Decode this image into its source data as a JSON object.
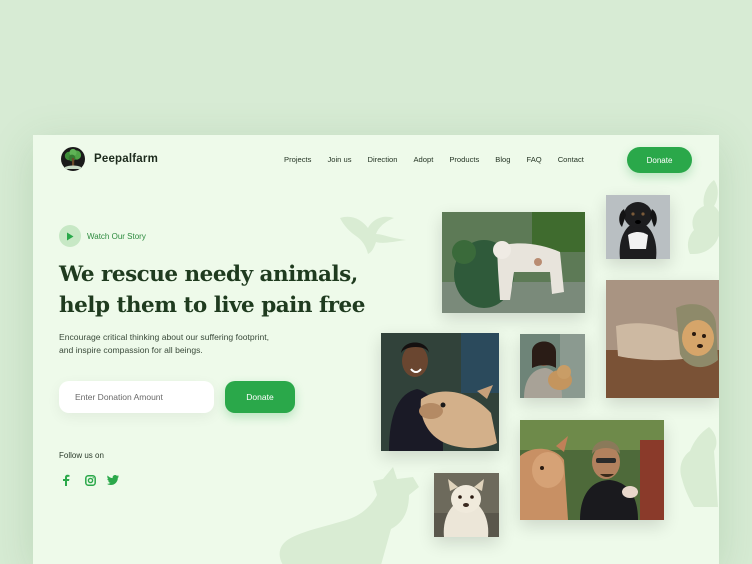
{
  "brand": {
    "name": "Peepalfarm",
    "logo_icon": "peepal-tree-logo-icon"
  },
  "nav": {
    "items": [
      "Projects",
      "Join us",
      "Direction",
      "Adopt",
      "Products",
      "Blog",
      "FAQ",
      "Contact"
    ],
    "donate_label": "Donate"
  },
  "hero": {
    "watch_label": "Watch Our Story",
    "headline_line1": "We rescue needy animals,",
    "headline_line2": "help them to live pain free",
    "subtext_line1": "Encourage critical thinking about our suffering footprint,",
    "subtext_line2": "and inspire compassion for all beings.",
    "donation_placeholder": "Enter Donation Amount",
    "donate_label": "Donate"
  },
  "social": {
    "follow_label": "Follow us on",
    "icons": [
      "facebook-icon",
      "instagram-icon",
      "twitter-icon"
    ]
  },
  "colors": {
    "accent": "#2aa84a",
    "page_background": "#d7ebd4",
    "card_background": "#eefaea",
    "headline": "#1f3b1f"
  },
  "photos": [
    "man-hugging-goat-photo",
    "black-puppy-photo",
    "dog-with-cone-photo",
    "woman-with-cow-photo",
    "woman-holding-puppy-photo",
    "man-with-calf-photo",
    "white-dog-photo"
  ]
}
